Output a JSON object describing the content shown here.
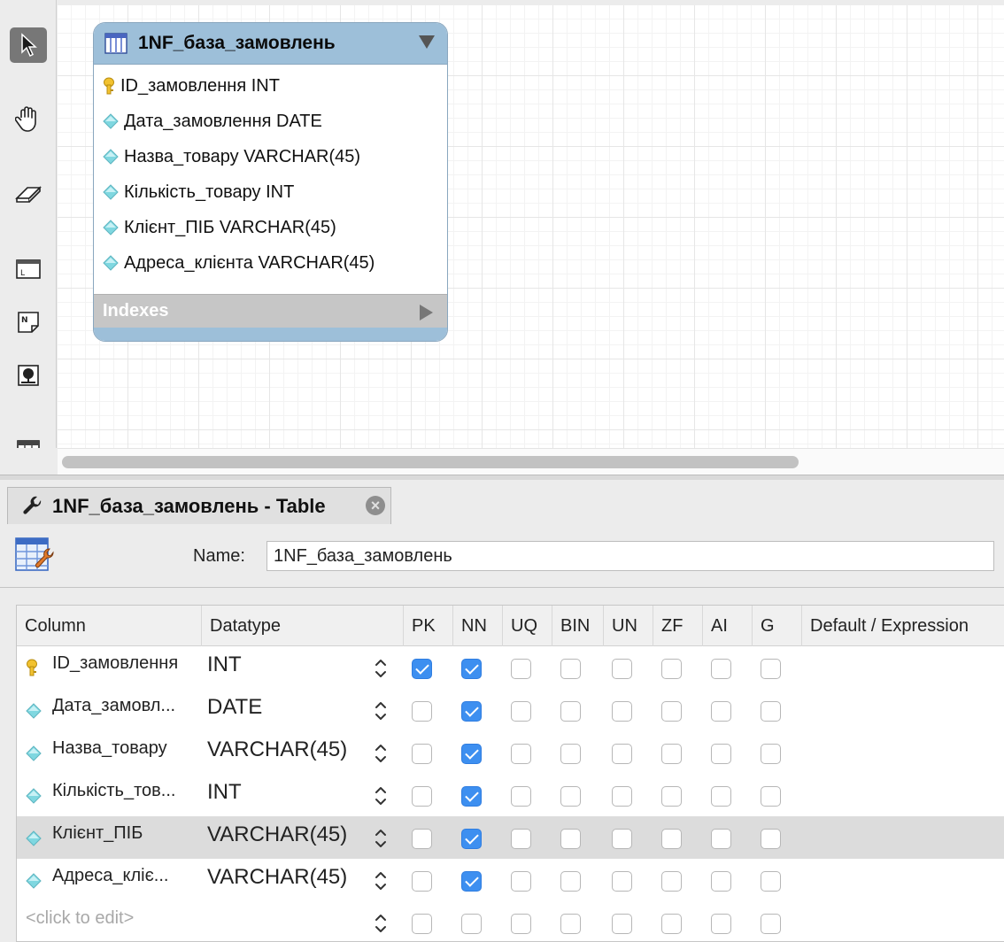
{
  "toolbar": {
    "tools": [
      "pointer-tool",
      "hand-tool",
      "eraser-tool",
      "layer-tool",
      "note-tool",
      "image-tool",
      "table-tool"
    ]
  },
  "diagram": {
    "entity": {
      "title": "1NF_база_замовлень",
      "columns": [
        {
          "key": "pk",
          "label": "ID_замовлення INT"
        },
        {
          "key": "col",
          "label": "Дата_замовлення DATE"
        },
        {
          "key": "col",
          "label": "Назва_товару VARCHAR(45)"
        },
        {
          "key": "col",
          "label": "Кількість_товару INT"
        },
        {
          "key": "col",
          "label": "Клієнт_ПІБ VARCHAR(45)"
        },
        {
          "key": "col",
          "label": "Адреса_клієнта VARCHAR(45)"
        }
      ],
      "indexes_label": "Indexes"
    }
  },
  "editor": {
    "tab_title": "1NF_база_замовлень - Table",
    "name_label": "Name:",
    "name_value": "1NF_база_замовлень",
    "headers": [
      "Column",
      "Datatype",
      "PK",
      "NN",
      "UQ",
      "BIN",
      "UN",
      "ZF",
      "AI",
      "G",
      "Default / Expression"
    ],
    "rows": [
      {
        "name": "ID_замовлення",
        "type": "INT",
        "key": "pk",
        "flags": [
          true,
          true,
          false,
          false,
          false,
          false,
          false,
          false
        ]
      },
      {
        "name": "Дата_замовл...",
        "type": "DATE",
        "key": "col",
        "flags": [
          false,
          true,
          false,
          false,
          false,
          false,
          false,
          false
        ]
      },
      {
        "name": "Назва_товару",
        "type": "VARCHAR(45)",
        "key": "col",
        "flags": [
          false,
          true,
          false,
          false,
          false,
          false,
          false,
          false
        ]
      },
      {
        "name": "Кількість_тов...",
        "type": "INT",
        "key": "col",
        "flags": [
          false,
          true,
          false,
          false,
          false,
          false,
          false,
          false
        ]
      },
      {
        "name": "Клієнт_ПІБ",
        "type": "VARCHAR(45)",
        "key": "col",
        "flags": [
          false,
          true,
          false,
          false,
          false,
          false,
          false,
          false
        ],
        "selected": true
      },
      {
        "name": "Адреса_кліє...",
        "type": "VARCHAR(45)",
        "key": "col",
        "flags": [
          false,
          true,
          false,
          false,
          false,
          false,
          false,
          false
        ]
      },
      {
        "name": "<click to edit>",
        "type": "",
        "key": "none",
        "placeholder": true,
        "flags": [
          false,
          false,
          false,
          false,
          false,
          false,
          false,
          false
        ]
      }
    ]
  },
  "colors": {
    "entity_header": "#9dbfd9",
    "checkbox_checked": "#3d8ff0",
    "selected_row": "#dcdcdc"
  }
}
